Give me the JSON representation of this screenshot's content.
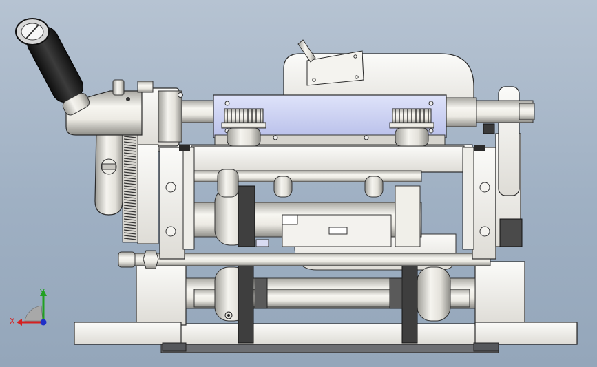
{
  "viewport": {
    "background_top": "#b6c3d2",
    "background_bottom": "#94a6ba"
  },
  "triad": {
    "x_label": "X",
    "y_label": "Y",
    "x_color": "#d62020",
    "y_color": "#22a022",
    "z_color": "#2030c8"
  },
  "model": {
    "metal_color": "#e6e3dc",
    "dark_color": "#4a4a4a",
    "plate_color": "#c9cff0",
    "grip_color": "#1e1e1e"
  }
}
